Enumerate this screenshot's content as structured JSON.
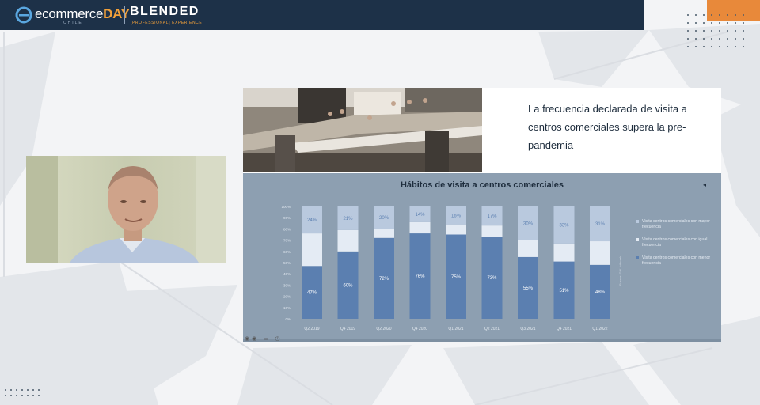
{
  "header": {
    "brand_prefix": "ecommerce",
    "brand_suffix": "DAY",
    "brand_country": "CHILE",
    "event_name": "BLENDED",
    "event_tagline": "[PROFESSIONAL] EXPERIENCE"
  },
  "colors": {
    "topbar": "#1d3148",
    "accent": "#f2a13a",
    "panel": "#8d9fb1",
    "series_low": "#5b7fb0",
    "series_mid": "#e4ebf4",
    "series_high": "#b9c9de"
  },
  "slide": {
    "headline": "La frecuencia declarada de visita a centros comerciales supera la pre-pandemia"
  },
  "chart_data": {
    "type": "bar",
    "stacked": true,
    "title": "Hábitos de visita a centros comerciales",
    "categories": [
      "Q2 2019",
      "Q4 2019",
      "Q2 2020",
      "Q4 2020",
      "Q1 2021",
      "Q2 2021",
      "Q3 2021",
      "Q4 2021",
      "Q1 2022"
    ],
    "y_ticks": [
      "0%",
      "10%",
      "20%",
      "30%",
      "40%",
      "50%",
      "60%",
      "70%",
      "80%",
      "90%",
      "100%"
    ],
    "ylim": [
      0,
      100
    ],
    "series": [
      {
        "name": "Visita centros comerciales con menor frecuencia",
        "values": [
          47,
          60,
          72,
          76,
          75,
          73,
          55,
          51,
          48
        ],
        "labels": [
          "47%",
          "60%",
          "72%",
          "76%",
          "75%",
          "73%",
          "55%",
          "51%",
          "48%"
        ]
      },
      {
        "name": "Visita centros comerciales con igual frecuencia",
        "values": [
          29,
          19,
          8,
          10,
          9,
          10,
          15,
          16,
          21
        ],
        "labels": [
          "",
          "",
          "",
          "",
          "",
          "",
          "",
          "",
          ""
        ]
      },
      {
        "name": "Visita centros comerciales con mayor frecuencia",
        "values": [
          24,
          21,
          20,
          14,
          16,
          17,
          30,
          33,
          31
        ],
        "labels": [
          "24%",
          "21%",
          "20%",
          "14%",
          "16%",
          "17%",
          "30%",
          "33%",
          "31%"
        ]
      }
    ],
    "legend_position": "right",
    "grid": false,
    "source_note": "Fuente: GfK Adimark"
  }
}
